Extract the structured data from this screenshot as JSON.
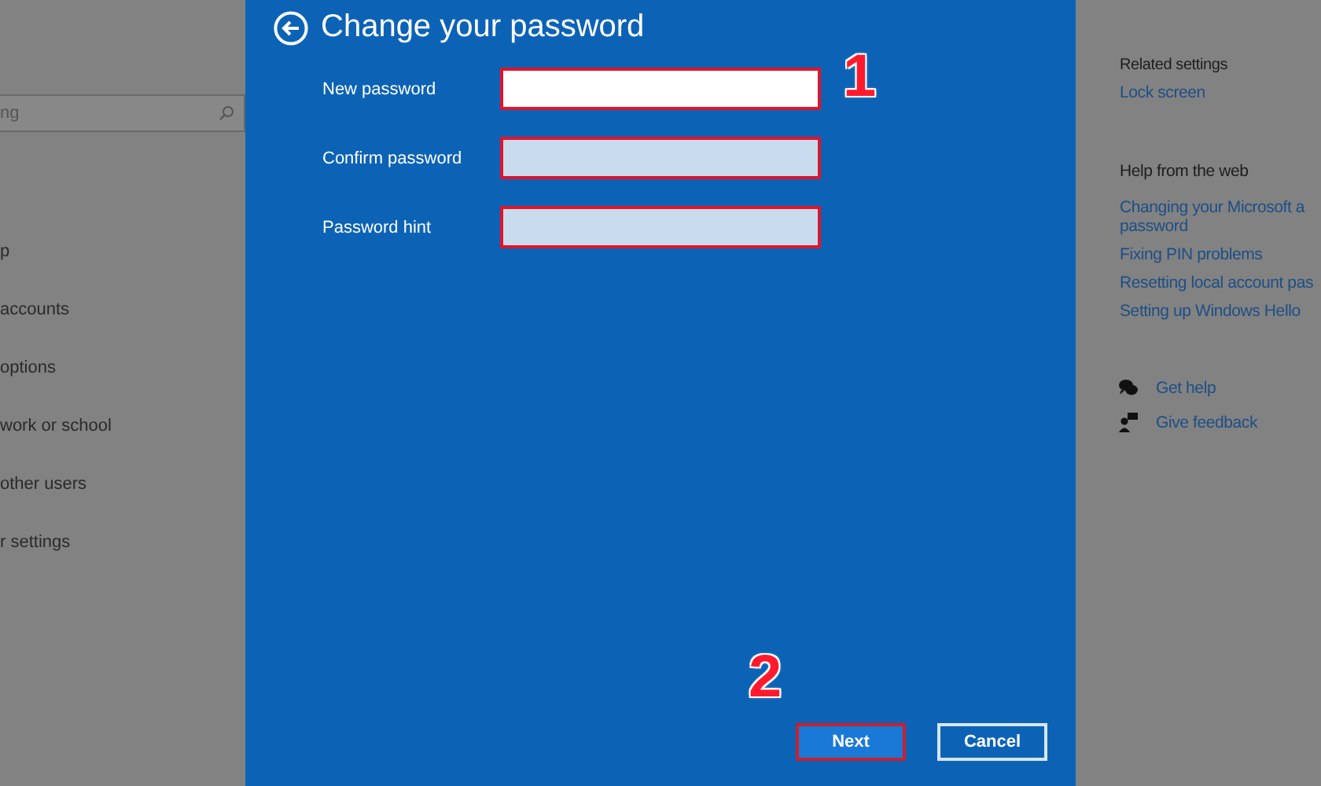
{
  "left_panel": {
    "search": {
      "placeholder": "ng"
    },
    "items": [
      {
        "label": "p"
      },
      {
        "label": "accounts"
      },
      {
        "label": "options"
      },
      {
        "label": "work or school"
      },
      {
        "label": "other users"
      },
      {
        "label": "r settings"
      }
    ]
  },
  "dialog": {
    "title": "Change your password",
    "fields": [
      {
        "label": "New password",
        "focused": true,
        "highlighted": true
      },
      {
        "label": "Confirm password",
        "focused": false,
        "highlighted": true
      },
      {
        "label": "Password hint",
        "focused": false,
        "highlighted": true
      }
    ],
    "buttons": [
      {
        "label": "Next",
        "kind": "primary",
        "highlighted": true
      },
      {
        "label": "Cancel",
        "kind": "secondary",
        "highlighted": false
      }
    ],
    "annotations": [
      "1",
      "2"
    ]
  },
  "right_panel": {
    "related_heading": "Related settings",
    "related_links": [
      "Lock screen"
    ],
    "help_heading": "Help from the web",
    "help_links": [
      "Changing your Microsoft a password",
      "Fixing PIN problems",
      "Resetting local account pas",
      "Setting up Windows Hello"
    ],
    "actions": [
      {
        "label": "Get help",
        "kind": "help"
      },
      {
        "label": "Give feedback",
        "kind": "feedback"
      }
    ]
  }
}
